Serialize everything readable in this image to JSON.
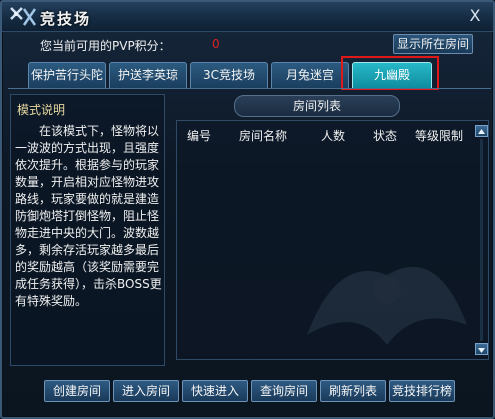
{
  "window": {
    "title": "竞技场",
    "close_glyph": "X"
  },
  "header": {
    "pvp_label": "您当前可用的PVP积分：",
    "pvp_value": "0",
    "show_room_button": "显示所在房间"
  },
  "tabs": [
    {
      "label": "保护苦行头陀",
      "active": false
    },
    {
      "label": "护送李英琼",
      "active": false
    },
    {
      "label": "3C竞技场",
      "active": false
    },
    {
      "label": "月兔迷宫",
      "active": false
    },
    {
      "label": "九幽殿",
      "active": true
    }
  ],
  "mode": {
    "title": "模式说明",
    "description": "在该模式下，怪物将以一波波的方式出现，且强度依次提升。根据参与的玩家数量，开启相对应怪物进攻路线，玩家要做的就是建造防御炮塔打倒怪物，阻止怪物走进中央的大门。波数越多，剩余存活玩家越多最后的奖励越高（该奖励需要完成任务获得），击杀BOSS更有特殊奖励。"
  },
  "room_list": {
    "title": "房间列表",
    "columns": [
      "编号",
      "房间名称",
      "人数",
      "状态",
      "等级限制"
    ],
    "rows": []
  },
  "buttons": {
    "create_room": "创建房间",
    "join_room": "进入房间",
    "quick_join": "快速进入",
    "search_room": "查询房间",
    "refresh_list": "刷新列表",
    "ranking": "竞技排行榜"
  },
  "colors": {
    "accent": "#28b8c8",
    "pvp_value": "#e02020",
    "highlight_box": "#e01818"
  }
}
